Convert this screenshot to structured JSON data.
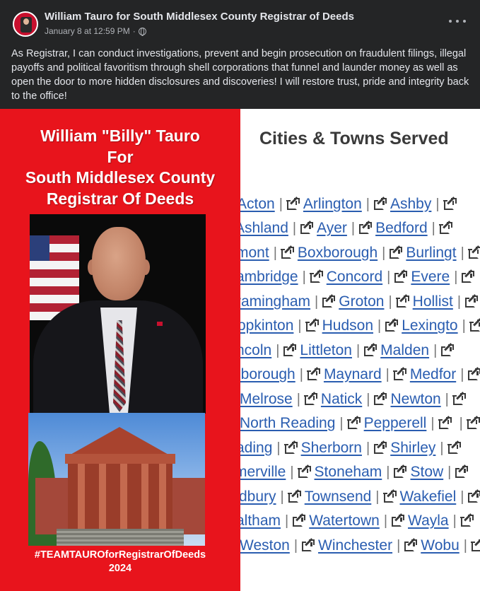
{
  "post": {
    "author": "William Tauro for South Middlesex County Registrar of Deeds",
    "timestamp": "January 8 at 12:59 PM",
    "dot": "·",
    "privacy_icon": "globe-icon",
    "more_icon": "more-options-icon",
    "text": "As Registrar, I can conduct investigations, prevent and begin prosecution on fraudulent filings, illegal payoffs and political favoritism through shell corporations that funnel and launder money as well as open the door to more hidden disclosures and discoveries! I will restore trust, pride and integrity back to the office!"
  },
  "poster": {
    "background": "#e8141c",
    "title_lines": [
      "William \"Billy\" Tauro",
      "For",
      "South Middlesex County",
      "Registrar Of Deeds"
    ],
    "hashtag": "#TEAMTAUROforRegistrarOfDeeds",
    "year": "2024"
  },
  "towns": {
    "title": "Cities & Towns Served",
    "separator": "|",
    "link_icon": "external-link-icon",
    "link_color": "#2a5db0",
    "rows": [
      [
        "Acton",
        "Arlington",
        "Ashby"
      ],
      [
        "Ashland",
        "Ayer",
        "Bedford"
      ],
      [
        "mont",
        "Boxborough",
        "Burlingt"
      ],
      [
        "ambridge",
        "Concord",
        "Evere"
      ],
      [
        "ramingham",
        "Groton",
        "Hollist"
      ],
      [
        "opkinton",
        "Hudson",
        "Lexingto"
      ],
      [
        "ncoln",
        "Littleton",
        "Malden"
      ],
      [
        "lborough",
        "Maynard",
        "Medfor"
      ],
      [
        "Melrose",
        "Natick",
        "Newton"
      ],
      [
        "North Reading",
        "Pepperell",
        ""
      ],
      [
        "ading",
        "Sherborn",
        "Shirley"
      ],
      [
        "merville",
        "Stoneham",
        "Stow"
      ],
      [
        "dbury",
        "Townsend",
        "Wakefiel"
      ],
      [
        "altham",
        "Watertown",
        "Wayla"
      ],
      [
        "Weston",
        "Winchester",
        "Wobu"
      ]
    ]
  }
}
